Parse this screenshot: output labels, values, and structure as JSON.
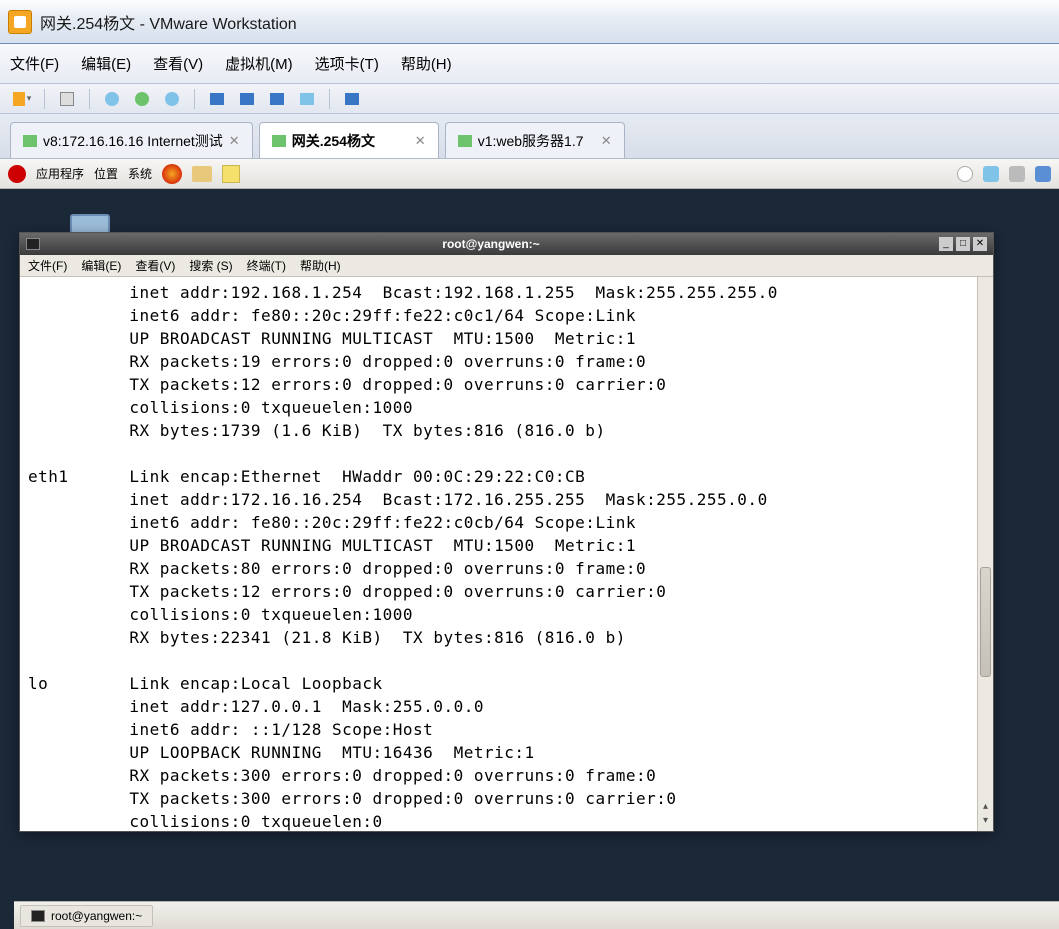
{
  "vmware": {
    "title": "网关.254杨文 - VMware Workstation",
    "menu": {
      "file": "文件(F)",
      "edit": "编辑(E)",
      "view": "查看(V)",
      "vm": "虚拟机(M)",
      "tabs": "选项卡(T)",
      "help": "帮助(H)"
    },
    "tabs": [
      {
        "label": "v8:172.16.16.16 Internet测试",
        "active": false
      },
      {
        "label": "网关.254杨文",
        "active": true
      },
      {
        "label": "v1:web服务器1.7",
        "active": false
      }
    ]
  },
  "gnome_panel": {
    "apps": "应用程序",
    "places": "位置",
    "system": "系统"
  },
  "terminal": {
    "title": "root@yangwen:~",
    "menu": {
      "file": "文件(F)",
      "edit": "编辑(E)",
      "view": "查看(V)",
      "search": "搜索 (S)",
      "terminal": "终端(T)",
      "help": "帮助(H)"
    },
    "output": "          inet addr:192.168.1.254  Bcast:192.168.1.255  Mask:255.255.255.0\n          inet6 addr: fe80::20c:29ff:fe22:c0c1/64 Scope:Link\n          UP BROADCAST RUNNING MULTICAST  MTU:1500  Metric:1\n          RX packets:19 errors:0 dropped:0 overruns:0 frame:0\n          TX packets:12 errors:0 dropped:0 overruns:0 carrier:0\n          collisions:0 txqueuelen:1000\n          RX bytes:1739 (1.6 KiB)  TX bytes:816 (816.0 b)\n\neth1      Link encap:Ethernet  HWaddr 00:0C:29:22:C0:CB\n          inet addr:172.16.16.254  Bcast:172.16.255.255  Mask:255.255.0.0\n          inet6 addr: fe80::20c:29ff:fe22:c0cb/64 Scope:Link\n          UP BROADCAST RUNNING MULTICAST  MTU:1500  Metric:1\n          RX packets:80 errors:0 dropped:0 overruns:0 frame:0\n          TX packets:12 errors:0 dropped:0 overruns:0 carrier:0\n          collisions:0 txqueuelen:1000\n          RX bytes:22341 (21.8 KiB)  TX bytes:816 (816.0 b)\n\nlo        Link encap:Local Loopback\n          inet addr:127.0.0.1  Mask:255.0.0.0\n          inet6 addr: ::1/128 Scope:Host\n          UP LOOPBACK RUNNING  MTU:16436  Metric:1\n          RX packets:300 errors:0 dropped:0 overruns:0 frame:0\n          TX packets:300 errors:0 dropped:0 overruns:0 carrier:0\n          collisions:0 txqueuelen:0"
  },
  "taskbar": {
    "item1": "root@yangwen:~"
  }
}
